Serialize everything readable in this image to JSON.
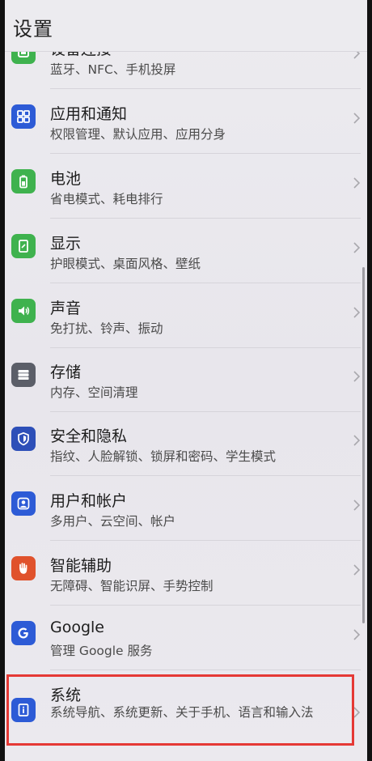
{
  "header": {
    "title": "设置"
  },
  "items": [
    {
      "key": "connections",
      "title": "设备连接",
      "subtitle": "蓝牙、NFC、手机投屏",
      "icon": "device-connection-icon",
      "color": "#3fb24e"
    },
    {
      "key": "apps",
      "title": "应用和通知",
      "subtitle": "权限管理、默认应用、应用分身",
      "icon": "apps-grid-icon",
      "color": "#2d5bd6"
    },
    {
      "key": "battery",
      "title": "电池",
      "subtitle": "省电模式、耗电排行",
      "icon": "battery-icon",
      "color": "#3fb24e"
    },
    {
      "key": "display",
      "title": "显示",
      "subtitle": "护眼模式、桌面风格、壁纸",
      "icon": "display-icon",
      "color": "#3fb24e"
    },
    {
      "key": "sound",
      "title": "声音",
      "subtitle": "免打扰、铃声、振动",
      "icon": "speaker-icon",
      "color": "#3fb24e"
    },
    {
      "key": "storage",
      "title": "存储",
      "subtitle": "内存、空间清理",
      "icon": "storage-icon",
      "color": "#5b5e68"
    },
    {
      "key": "security",
      "title": "安全和隐私",
      "subtitle": "指纹、人脸解锁、锁屏和密码、学生模式",
      "icon": "shield-icon",
      "color": "#2d4fb8"
    },
    {
      "key": "users",
      "title": "用户和帐户",
      "subtitle": "多用户、云空间、帐户",
      "icon": "user-icon",
      "color": "#2d5bd6"
    },
    {
      "key": "accessibility",
      "title": "智能辅助",
      "subtitle": "无障碍、智能识屏、手势控制",
      "icon": "hand-icon",
      "color": "#e0522c"
    },
    {
      "key": "google",
      "title": "Google",
      "subtitle": "管理 Google 服务",
      "icon": "google-icon",
      "color": "#2d5bd6"
    },
    {
      "key": "system",
      "title": "系统",
      "subtitle": "系统导航、系统更新、关于手机、语言和输入法",
      "icon": "system-info-icon",
      "color": "#2d5bd6"
    }
  ]
}
